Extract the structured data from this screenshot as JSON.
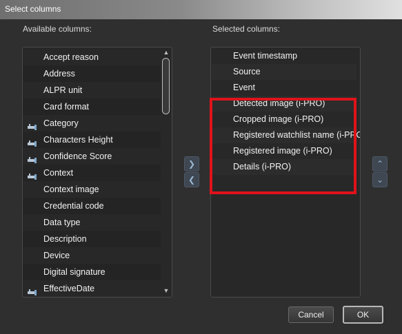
{
  "dialog": {
    "title": "Select columns"
  },
  "available": {
    "label": "Available columns:",
    "items": [
      {
        "label": "Accept reason",
        "icon": null
      },
      {
        "label": "Address",
        "icon": null
      },
      {
        "label": "ALPR unit",
        "icon": null
      },
      {
        "label": "Card format",
        "icon": null
      },
      {
        "label": "Category",
        "icon": "custom-field-icon"
      },
      {
        "label": "Characters Height",
        "icon": "custom-field-icon"
      },
      {
        "label": "Confidence Score",
        "icon": "custom-field-icon"
      },
      {
        "label": "Context",
        "icon": "custom-field-icon"
      },
      {
        "label": "Context image",
        "icon": null
      },
      {
        "label": "Credential code",
        "icon": null
      },
      {
        "label": "Data type",
        "icon": null
      },
      {
        "label": "Description",
        "icon": null
      },
      {
        "label": "Device",
        "icon": null
      },
      {
        "label": "Digital signature",
        "icon": null
      },
      {
        "label": "EffectiveDate",
        "icon": "custom-field-icon"
      }
    ]
  },
  "selected": {
    "label": "Selected columns:",
    "items": [
      "Event timestamp",
      "Source",
      "Event",
      "Detected image (i-PRO)",
      "Cropped image (i-PRO)",
      "Registered watchlist name (i-PRO)",
      "Registered image (i-PRO)",
      "Details (i-PRO)"
    ]
  },
  "buttons": {
    "cancel": "Cancel",
    "ok": "OK"
  },
  "colors": {
    "highlight": "#e0121b",
    "background": "#2f2f2f"
  }
}
